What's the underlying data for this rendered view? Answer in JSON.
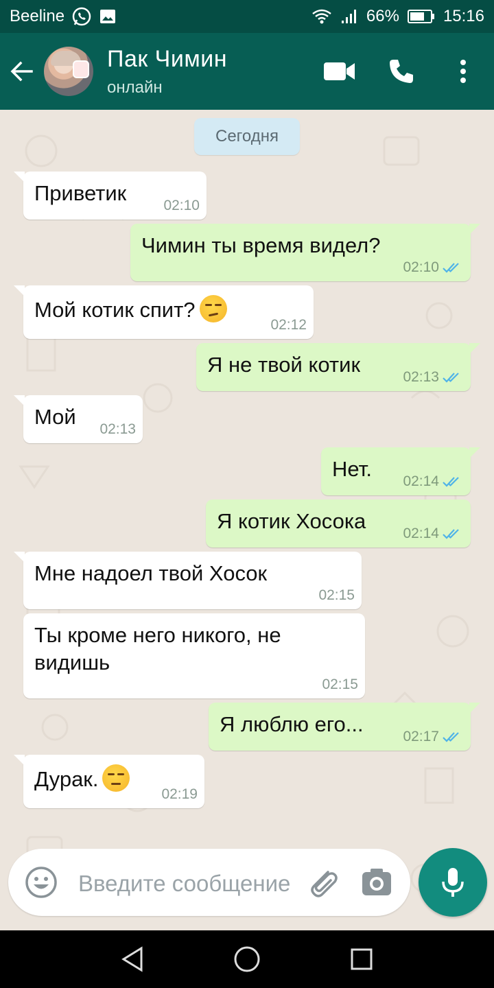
{
  "status_bar": {
    "carrier": "Beeline",
    "battery": "66%",
    "time": "15:16"
  },
  "header": {
    "contact_name": "Пак Чимин",
    "contact_status": "онлайн"
  },
  "chat": {
    "date_chip": "Сегодня",
    "messages": [
      {
        "direction": "in",
        "text": "Приветик",
        "time": "02:10"
      },
      {
        "direction": "out",
        "text": "Чимин ты время видел?",
        "time": "02:10",
        "read": true
      },
      {
        "direction": "in",
        "text": "Мой котик спит?",
        "emoji": "smirk",
        "time": "02:12"
      },
      {
        "direction": "out",
        "text": "Я не твой котик",
        "time": "02:13",
        "read": true
      },
      {
        "direction": "in",
        "text": "Мой",
        "time": "02:13"
      },
      {
        "direction": "out",
        "text": "Нет.",
        "time": "02:14",
        "read": true
      },
      {
        "direction": "out",
        "text": "Я котик Хосока",
        "time": "02:14",
        "read": true
      },
      {
        "direction": "in",
        "text": "Мне надоел твой Хосок",
        "time": "02:15"
      },
      {
        "direction": "in",
        "text": "Ты кроме него никого, не видишь",
        "time": "02:15"
      },
      {
        "direction": "out",
        "text": "Я люблю его...",
        "time": "02:17",
        "read": true
      },
      {
        "direction": "in",
        "text": "Дурак.",
        "emoji": "unamused",
        "time": "02:19"
      }
    ]
  },
  "composer": {
    "placeholder": "Введите сообщение"
  },
  "colors": {
    "header": "#075e54",
    "status_bar": "#054d44",
    "chat_bg": "#ece5dd",
    "incoming": "#ffffff",
    "outgoing": "#dcf8c6",
    "mic_button": "#128c7e",
    "read_ticks": "#4fb3e8"
  }
}
